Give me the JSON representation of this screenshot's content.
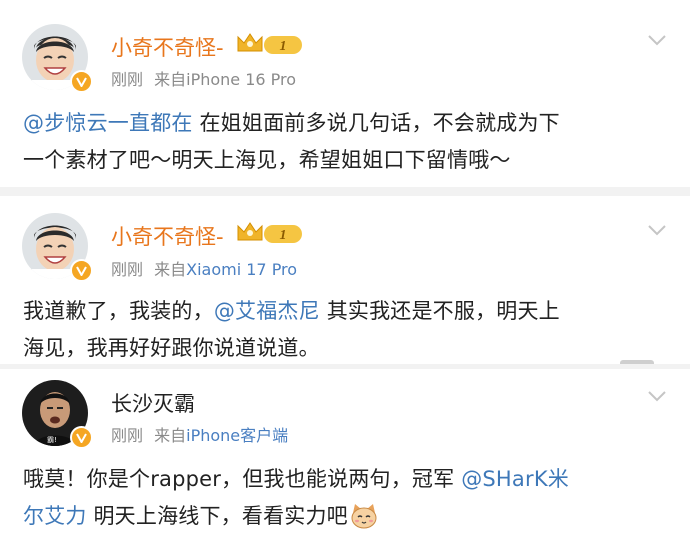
{
  "posts": [
    {
      "username": "小奇不奇怪-",
      "time": "刚刚",
      "source_prefix": "来自",
      "device": "iPhone 16 Pro",
      "vip_level": "1",
      "mention": "@步惊云一直都在",
      "text_line1_rest": " 在姐姐面前多说几句话，不会就成为下",
      "text_line2": "一个素材了吧～明天上海见，希望姐姐口下留情哦～",
      "colors": {
        "name": "#e8761c"
      }
    },
    {
      "username": "小奇不奇怪-",
      "time": "刚刚",
      "source_prefix": "来自",
      "device": "Xiaomi 17 Pro",
      "vip_level": "1",
      "text_line1_pre": "我道歉了，我装的，",
      "mention": "@艾福杰尼",
      "text_line1_post": " 其实我还是不服，明天上",
      "text_line2": "海见，我再好好跟你说道说道。",
      "colors": {
        "name": "#e8761c"
      }
    },
    {
      "username": "长沙灭霸",
      "time": "刚刚",
      "source_prefix": "来自",
      "device": "iPhone客户端",
      "text_line1_pre": "哦莫！你是个rapper，但我也能说两句，冠军 ",
      "mention_line1": "@SHarK米",
      "mention_line2": "尔艾力",
      "text_line2_post": " 明天上海线下，看看实力吧",
      "emoji": "cat-face-icon",
      "colors": {
        "name": "#222222"
      }
    }
  ]
}
